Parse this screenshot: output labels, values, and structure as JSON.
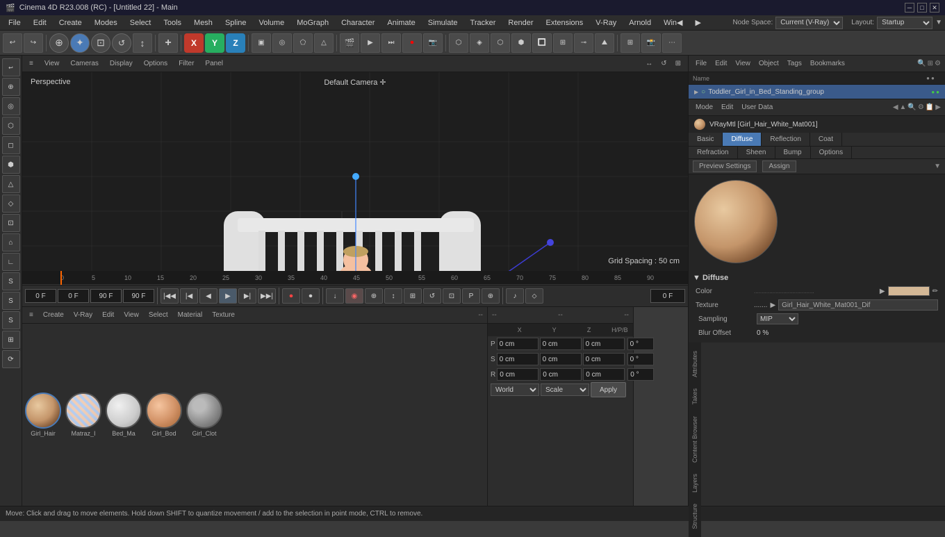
{
  "titlebar": {
    "title": "Cinema 4D R23.008 (RC) - [Untitled 22] - Main",
    "icon": "🎬"
  },
  "menubar": {
    "items": [
      "File",
      "Edit",
      "Create",
      "Modes",
      "Select",
      "Tools",
      "Mesh",
      "Spline",
      "Volume",
      "MoGraph",
      "Character",
      "Animate",
      "Simulate",
      "Tracker",
      "Render",
      "Extensions",
      "V-Ray",
      "Arnold",
      "Win◀",
      "▶"
    ],
    "node_space_label": "Node Space:",
    "node_space_value": "Current (V-Ray)",
    "layout_label": "Layout:",
    "layout_value": "Startup"
  },
  "toolbar": {
    "undo_label": "↩",
    "redo_label": "↪",
    "axis_x": "X",
    "axis_y": "Y",
    "axis_z": "Z"
  },
  "viewport": {
    "perspective_label": "Perspective",
    "camera_label": "Default Camera ✛",
    "grid_spacing": "Grid Spacing : 50 cm",
    "toolbar_items": [
      "≡",
      "View",
      "Cameras",
      "Display",
      "Options",
      "Filter",
      "Panel"
    ]
  },
  "object_panel": {
    "toolbar_items": [
      "File",
      "Edit",
      "View",
      "Object",
      "Tags",
      "Bookmarks"
    ],
    "objects": [
      {
        "name": "Toddler_Girl_in_Bed_Standing_group",
        "selected": true,
        "icon": "▶",
        "color": "green"
      }
    ]
  },
  "attr_panel": {
    "toolbar_items": [
      "Mode",
      "Edit",
      "User Data"
    ],
    "nav_arrows": [
      "◀",
      "▲",
      "🔍",
      "⚙",
      "📋",
      "▶"
    ],
    "material_name": "VRayMtl [Girl_Hair_White_Mat001]",
    "tabs": [
      "Basic",
      "Diffuse",
      "Reflection",
      "Coat",
      "Refraction",
      "Sheen",
      "Bump",
      "Options"
    ],
    "active_tab": "Diffuse",
    "sub_rows": [
      "Preview Settings",
      "Assign"
    ],
    "diffuse": {
      "header": "Diffuse",
      "color_label": "Color",
      "color_dots": "..................",
      "color_swatch": "#d4b896",
      "texture_label": "Texture",
      "texture_name": "Girl_Hair_White_Mat001_Dif",
      "sampling_label": "Sampling",
      "sampling_value": "MIP",
      "blur_label": "Blur Offset",
      "blur_value": "0 %"
    }
  },
  "timeline": {
    "frame_values": [
      "0",
      "5",
      "10",
      "15",
      "20",
      "25",
      "30",
      "35",
      "40",
      "45",
      "50",
      "55",
      "60",
      "65",
      "70",
      "75",
      "80",
      "85",
      "90"
    ],
    "current_frame": "0 F",
    "start_frame": "0 F",
    "end_frame": "90 F",
    "end_frame2": "90 F",
    "playback_btns": [
      "|◀◀",
      "|◀",
      "◀",
      "▶",
      "▶|",
      "▶▶|"
    ]
  },
  "material_panel": {
    "toolbar_items": [
      "≡",
      "Create",
      "V-Ray",
      "Edit",
      "View",
      "Select",
      "Material",
      "Texture"
    ],
    "label": "--",
    "materials": [
      {
        "name": "Girl_Hair",
        "type": "hair",
        "bg": "radial-gradient(circle at 35% 35%, #e8c9a0, #c4956a 50%, #7a5030 80%, #3a2010)",
        "selected": true
      },
      {
        "name": "Matraz_I",
        "type": "pattern",
        "bg": "radial-gradient(circle at 35% 35%, #eee 20%, #ddd 60%, #aaa)",
        "selected": false
      },
      {
        "name": "Bed_Ma",
        "type": "white",
        "bg": "radial-gradient(circle at 35% 35%, #f0f0f0, #ccc 60%, #999)",
        "selected": false
      },
      {
        "name": "Girl_Bod",
        "type": "skin",
        "bg": "radial-gradient(circle at 35% 35%, #f5c5a0, #d4956a 50%, #a06030)",
        "selected": false
      },
      {
        "name": "Girl_Clot",
        "type": "cloth",
        "bg": "radial-gradient(circle at 35% 35%, #bbb 20%, #888 60%, #555)",
        "selected": false
      }
    ]
  },
  "coord_panel": {
    "label": "--",
    "x_pos": "0 cm",
    "y_pos": "0 cm",
    "z_pos": "0 cm",
    "x_rot": "0 cm",
    "y_rot": "0 cm",
    "z_rot": "0 cm",
    "h": "0 °",
    "p": "0 °",
    "b": "0 °",
    "mode": "World",
    "scale_mode": "Scale",
    "apply_label": "Apply"
  },
  "statusbar": {
    "message": "Move: Click and drag to move elements. Hold down SHIFT to quantize movement / add to the selection in point mode, CTRL to remove."
  },
  "right_side_tabs": [
    "Attributes",
    "Takes",
    "Content Browser",
    "Layers",
    "Structure"
  ]
}
